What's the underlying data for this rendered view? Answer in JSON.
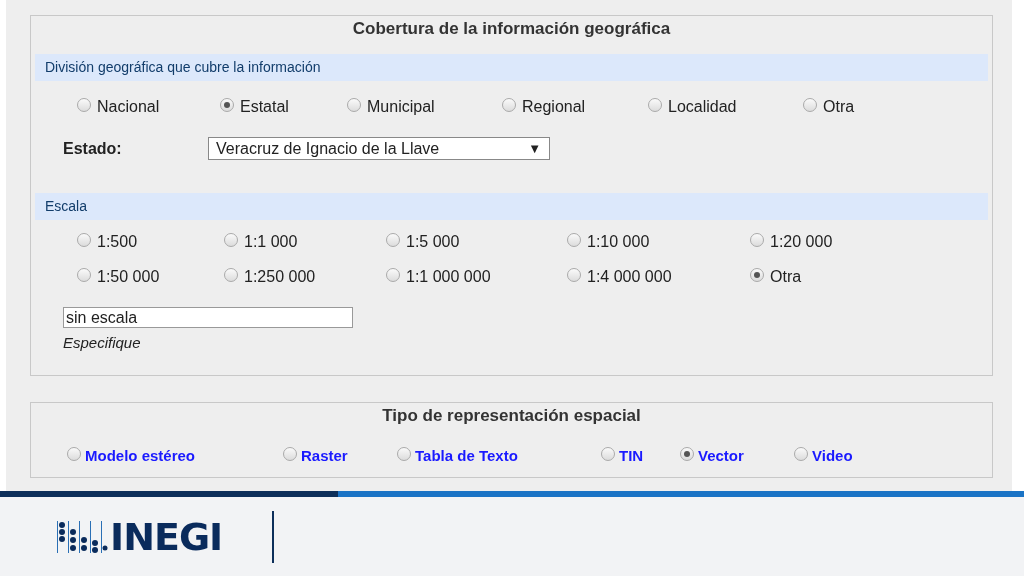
{
  "coverage": {
    "title": "Cobertura de la información geográfica",
    "division": {
      "heading": "División geográfica que cubre la información",
      "options": [
        {
          "label": "Nacional",
          "selected": false
        },
        {
          "label": "Estatal",
          "selected": true
        },
        {
          "label": "Municipal",
          "selected": false
        },
        {
          "label": "Regional",
          "selected": false
        },
        {
          "label": "Localidad",
          "selected": false
        },
        {
          "label": "Otra",
          "selected": false
        }
      ]
    },
    "state": {
      "label": "Estado:",
      "value": "Veracruz de Ignacio de la Llave",
      "arrow": "▼"
    },
    "scale": {
      "heading": "Escala",
      "options": [
        {
          "label": "1:500",
          "selected": false
        },
        {
          "label": "1:1 000",
          "selected": false
        },
        {
          "label": "1:5 000",
          "selected": false
        },
        {
          "label": "1:10 000",
          "selected": false
        },
        {
          "label": "1:20 000",
          "selected": false
        },
        {
          "label": "1:50 000",
          "selected": false
        },
        {
          "label": "1:250 000",
          "selected": false
        },
        {
          "label": "1:1 000 000",
          "selected": false
        },
        {
          "label": "1:4 000 000",
          "selected": false
        },
        {
          "label": "Otra",
          "selected": true
        }
      ],
      "other_value": "sin escala",
      "other_hint": "Especifique"
    }
  },
  "representation": {
    "title": "Tipo de representación espacial",
    "options": [
      {
        "label": "Modelo estéreo",
        "selected": false
      },
      {
        "label": "Raster",
        "selected": false
      },
      {
        "label": "Tabla de Texto",
        "selected": false
      },
      {
        "label": "TIN",
        "selected": false
      },
      {
        "label": "Vector",
        "selected": true
      },
      {
        "label": "Video",
        "selected": false
      }
    ]
  },
  "footer": {
    "logo": "INEGI"
  }
}
